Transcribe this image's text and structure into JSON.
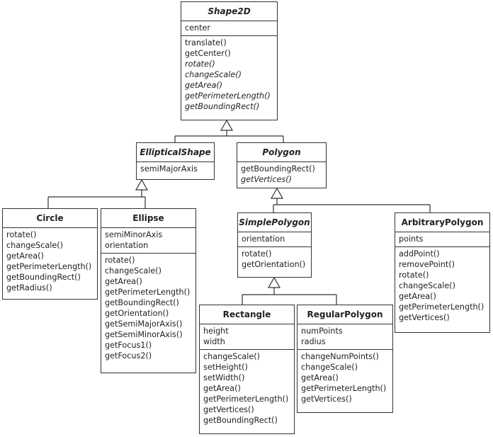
{
  "classes": [
    {
      "id": "shape2d",
      "name": "Shape2D",
      "abstract": true,
      "attributes": [
        "center"
      ],
      "methods": [
        {
          "n": "translate()"
        },
        {
          "n": "getCenter()"
        },
        {
          "n": "rotate()",
          "abstract": true
        },
        {
          "n": "changeScale()",
          "abstract": true
        },
        {
          "n": "getArea()",
          "abstract": true
        },
        {
          "n": "getPerimeterLength()",
          "abstract": true
        },
        {
          "n": "getBoundingRect()",
          "abstract": true
        }
      ]
    },
    {
      "id": "ellipticalshape",
      "name": "EllipticalShape",
      "abstract": true,
      "attributes": [
        "semiMajorAxis"
      ],
      "methods": []
    },
    {
      "id": "polygon",
      "name": "Polygon",
      "abstract": true,
      "attributes": [],
      "methods": [
        {
          "n": "getBoundingRect()"
        },
        {
          "n": "getVertices()",
          "abstract": true
        }
      ]
    },
    {
      "id": "circle",
      "name": "Circle",
      "abstract": false,
      "attributes": [],
      "methods": [
        {
          "n": "rotate()"
        },
        {
          "n": "changeScale()"
        },
        {
          "n": "getArea()"
        },
        {
          "n": "getPerimeterLength()"
        },
        {
          "n": "getBoundingRect()"
        },
        {
          "n": "getRadius()"
        }
      ]
    },
    {
      "id": "ellipse",
      "name": "Ellipse",
      "abstract": false,
      "attributes": [
        "semiMinorAxis",
        "orientation"
      ],
      "methods": [
        {
          "n": "rotate()"
        },
        {
          "n": "changeScale()"
        },
        {
          "n": "getArea()"
        },
        {
          "n": "getPerimeterLength()"
        },
        {
          "n": "getBoundingRect()"
        },
        {
          "n": "getOrientation()"
        },
        {
          "n": "getSemiMajorAxis()"
        },
        {
          "n": "getSemiMinorAxis()"
        },
        {
          "n": "getFocus1()"
        },
        {
          "n": "getFocus2()"
        }
      ]
    },
    {
      "id": "simplepolygon",
      "name": "SimplePolygon",
      "abstract": true,
      "attributes": [
        "orientation"
      ],
      "methods": [
        {
          "n": "rotate()"
        },
        {
          "n": "getOrientation()"
        }
      ]
    },
    {
      "id": "arbitrarypolygon",
      "name": "ArbitraryPolygon",
      "abstract": false,
      "attributes": [
        "points"
      ],
      "methods": [
        {
          "n": "addPoint()"
        },
        {
          "n": "removePoint()"
        },
        {
          "n": "rotate()"
        },
        {
          "n": "changeScale()"
        },
        {
          "n": "getArea()"
        },
        {
          "n": "getPerimeterLength()"
        },
        {
          "n": "getVertices()"
        }
      ]
    },
    {
      "id": "rectangle",
      "name": "Rectangle",
      "abstract": false,
      "attributes": [
        "height",
        "width"
      ],
      "methods": [
        {
          "n": "changeScale()"
        },
        {
          "n": "setHeight()"
        },
        {
          "n": "setWidth()"
        },
        {
          "n": "getArea()"
        },
        {
          "n": "getPerimeterLength()"
        },
        {
          "n": "getVertices()"
        },
        {
          "n": "getBoundingRect()"
        }
      ]
    },
    {
      "id": "regularpolygon",
      "name": "RegularPolygon",
      "abstract": false,
      "attributes": [
        "numPoints",
        "radius"
      ],
      "methods": [
        {
          "n": "changeNumPoints()"
        },
        {
          "n": "changeScale()"
        },
        {
          "n": "getArea()"
        },
        {
          "n": "getPerimeterLength()"
        },
        {
          "n": "getVertices()"
        }
      ]
    }
  ],
  "inheritance": [
    {
      "parent": "shape2d",
      "children": [
        "ellipticalshape",
        "polygon"
      ]
    },
    {
      "parent": "ellipticalshape",
      "children": [
        "circle",
        "ellipse"
      ]
    },
    {
      "parent": "polygon",
      "children": [
        "simplepolygon",
        "arbitrarypolygon"
      ]
    },
    {
      "parent": "simplepolygon",
      "children": [
        "rectangle",
        "regularpolygon"
      ]
    }
  ]
}
